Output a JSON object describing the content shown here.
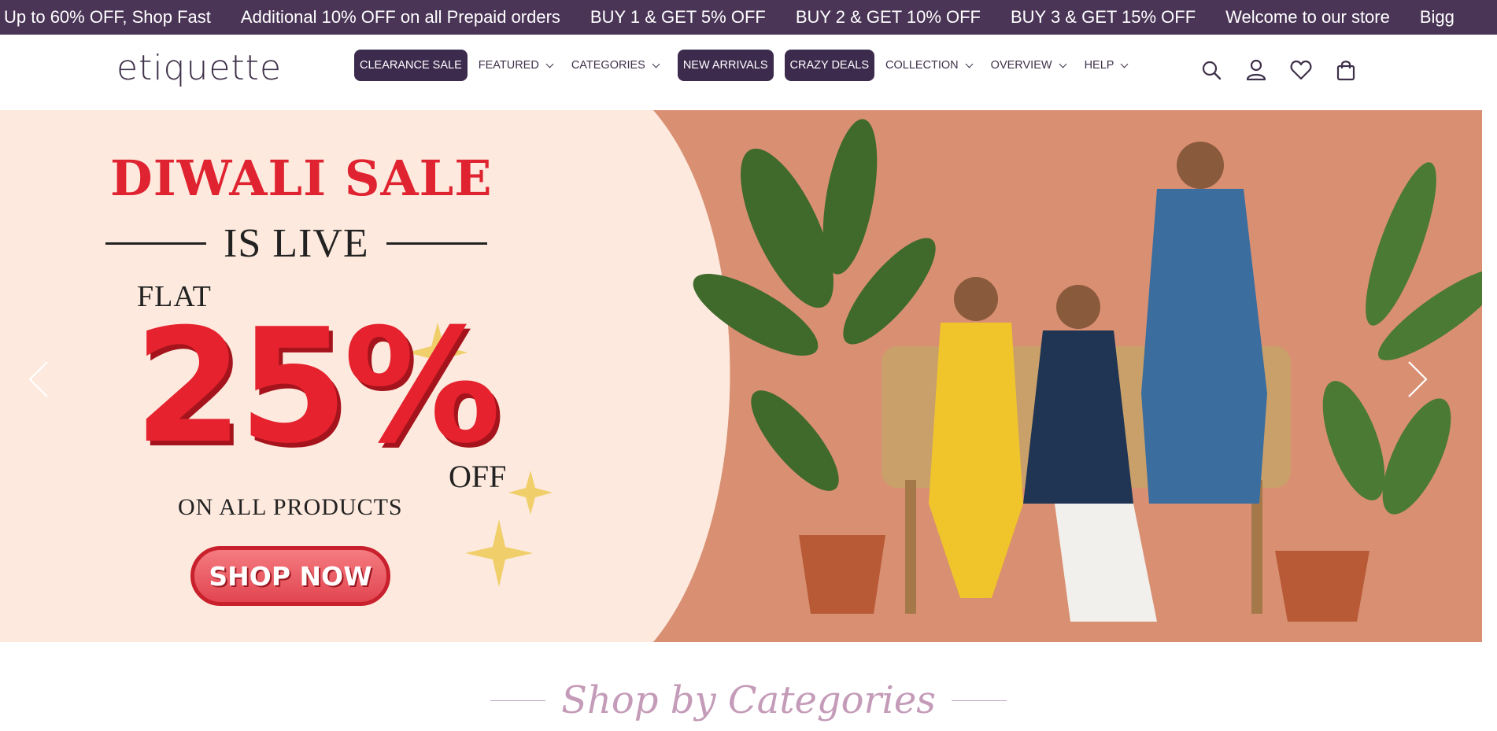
{
  "announcement": {
    "items": [
      "Up to 60% OFF, Shop Fast",
      "Additional 10% OFF on all Prepaid orders",
      "BUY 1 & GET 5% OFF",
      "BUY 2 & GET 10% OFF",
      "BUY 3 & GET 15% OFF",
      "Welcome to our store",
      "Bigg"
    ]
  },
  "header": {
    "logo": "etiquette",
    "nav": [
      {
        "label": "CLEARANCE SALE",
        "style": "pill"
      },
      {
        "label": "FEATURED",
        "style": "dropdown"
      },
      {
        "label": "CATEGORIES",
        "style": "dropdown"
      },
      {
        "label": "NEW ARRIVALS",
        "style": "pill"
      },
      {
        "label": "CRAZY DEALS",
        "style": "pill"
      },
      {
        "label": "COLLECTION",
        "style": "dropdown"
      },
      {
        "label": "OVERVIEW",
        "style": "dropdown"
      },
      {
        "label": "HELP",
        "style": "dropdown"
      }
    ],
    "icons": [
      "search-icon",
      "account-icon",
      "wishlist-heart-icon",
      "cart-bag-icon"
    ]
  },
  "hero": {
    "title": "DIWALI SALE",
    "subtitle": "IS LIVE",
    "flat": "FLAT",
    "discount": "25%",
    "off": "OFF",
    "on_all": "ON ALL PRODUCTS",
    "cta": "SHOP NOW"
  },
  "section": {
    "title": "Shop by Categories"
  },
  "colors": {
    "brand": "#4a3557",
    "pill": "#3d2b4e",
    "sale_red": "#e5222e",
    "hero_cream": "#fde9dd",
    "hero_terracotta": "#d68d70",
    "section_title": "#c49bb8"
  }
}
